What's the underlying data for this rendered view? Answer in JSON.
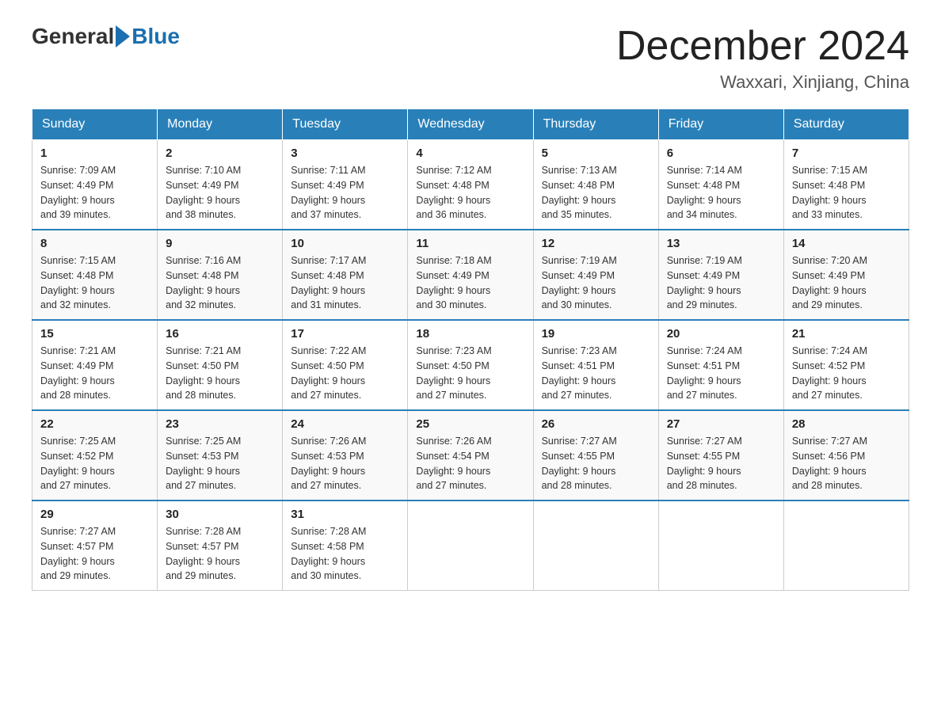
{
  "header": {
    "logo_general": "General",
    "logo_blue": "Blue",
    "month_title": "December 2024",
    "location": "Waxxari, Xinjiang, China"
  },
  "days_of_week": [
    "Sunday",
    "Monday",
    "Tuesday",
    "Wednesday",
    "Thursday",
    "Friday",
    "Saturday"
  ],
  "weeks": [
    [
      {
        "day": "1",
        "sunrise": "7:09 AM",
        "sunset": "4:49 PM",
        "daylight": "9 hours and 39 minutes."
      },
      {
        "day": "2",
        "sunrise": "7:10 AM",
        "sunset": "4:49 PM",
        "daylight": "9 hours and 38 minutes."
      },
      {
        "day": "3",
        "sunrise": "7:11 AM",
        "sunset": "4:49 PM",
        "daylight": "9 hours and 37 minutes."
      },
      {
        "day": "4",
        "sunrise": "7:12 AM",
        "sunset": "4:48 PM",
        "daylight": "9 hours and 36 minutes."
      },
      {
        "day": "5",
        "sunrise": "7:13 AM",
        "sunset": "4:48 PM",
        "daylight": "9 hours and 35 minutes."
      },
      {
        "day": "6",
        "sunrise": "7:14 AM",
        "sunset": "4:48 PM",
        "daylight": "9 hours and 34 minutes."
      },
      {
        "day": "7",
        "sunrise": "7:15 AM",
        "sunset": "4:48 PM",
        "daylight": "9 hours and 33 minutes."
      }
    ],
    [
      {
        "day": "8",
        "sunrise": "7:15 AM",
        "sunset": "4:48 PM",
        "daylight": "9 hours and 32 minutes."
      },
      {
        "day": "9",
        "sunrise": "7:16 AM",
        "sunset": "4:48 PM",
        "daylight": "9 hours and 32 minutes."
      },
      {
        "day": "10",
        "sunrise": "7:17 AM",
        "sunset": "4:48 PM",
        "daylight": "9 hours and 31 minutes."
      },
      {
        "day": "11",
        "sunrise": "7:18 AM",
        "sunset": "4:49 PM",
        "daylight": "9 hours and 30 minutes."
      },
      {
        "day": "12",
        "sunrise": "7:19 AM",
        "sunset": "4:49 PM",
        "daylight": "9 hours and 30 minutes."
      },
      {
        "day": "13",
        "sunrise": "7:19 AM",
        "sunset": "4:49 PM",
        "daylight": "9 hours and 29 minutes."
      },
      {
        "day": "14",
        "sunrise": "7:20 AM",
        "sunset": "4:49 PM",
        "daylight": "9 hours and 29 minutes."
      }
    ],
    [
      {
        "day": "15",
        "sunrise": "7:21 AM",
        "sunset": "4:49 PM",
        "daylight": "9 hours and 28 minutes."
      },
      {
        "day": "16",
        "sunrise": "7:21 AM",
        "sunset": "4:50 PM",
        "daylight": "9 hours and 28 minutes."
      },
      {
        "day": "17",
        "sunrise": "7:22 AM",
        "sunset": "4:50 PM",
        "daylight": "9 hours and 27 minutes."
      },
      {
        "day": "18",
        "sunrise": "7:23 AM",
        "sunset": "4:50 PM",
        "daylight": "9 hours and 27 minutes."
      },
      {
        "day": "19",
        "sunrise": "7:23 AM",
        "sunset": "4:51 PM",
        "daylight": "9 hours and 27 minutes."
      },
      {
        "day": "20",
        "sunrise": "7:24 AM",
        "sunset": "4:51 PM",
        "daylight": "9 hours and 27 minutes."
      },
      {
        "day": "21",
        "sunrise": "7:24 AM",
        "sunset": "4:52 PM",
        "daylight": "9 hours and 27 minutes."
      }
    ],
    [
      {
        "day": "22",
        "sunrise": "7:25 AM",
        "sunset": "4:52 PM",
        "daylight": "9 hours and 27 minutes."
      },
      {
        "day": "23",
        "sunrise": "7:25 AM",
        "sunset": "4:53 PM",
        "daylight": "9 hours and 27 minutes."
      },
      {
        "day": "24",
        "sunrise": "7:26 AM",
        "sunset": "4:53 PM",
        "daylight": "9 hours and 27 minutes."
      },
      {
        "day": "25",
        "sunrise": "7:26 AM",
        "sunset": "4:54 PM",
        "daylight": "9 hours and 27 minutes."
      },
      {
        "day": "26",
        "sunrise": "7:27 AM",
        "sunset": "4:55 PM",
        "daylight": "9 hours and 28 minutes."
      },
      {
        "day": "27",
        "sunrise": "7:27 AM",
        "sunset": "4:55 PM",
        "daylight": "9 hours and 28 minutes."
      },
      {
        "day": "28",
        "sunrise": "7:27 AM",
        "sunset": "4:56 PM",
        "daylight": "9 hours and 28 minutes."
      }
    ],
    [
      {
        "day": "29",
        "sunrise": "7:27 AM",
        "sunset": "4:57 PM",
        "daylight": "9 hours and 29 minutes."
      },
      {
        "day": "30",
        "sunrise": "7:28 AM",
        "sunset": "4:57 PM",
        "daylight": "9 hours and 29 minutes."
      },
      {
        "day": "31",
        "sunrise": "7:28 AM",
        "sunset": "4:58 PM",
        "daylight": "9 hours and 30 minutes."
      },
      null,
      null,
      null,
      null
    ]
  ],
  "labels": {
    "sunrise": "Sunrise:",
    "sunset": "Sunset:",
    "daylight": "Daylight:"
  }
}
